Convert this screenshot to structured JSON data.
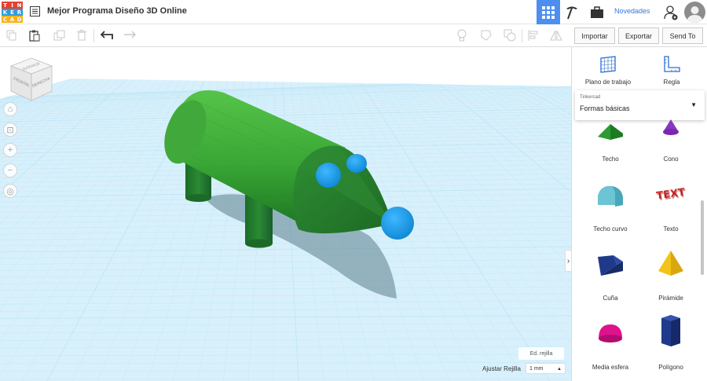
{
  "app": {
    "logo_letters": [
      "T",
      "I",
      "N",
      "K",
      "E",
      "R",
      "C",
      "A",
      "D"
    ],
    "logo_colors": [
      "#e4422f",
      "#e4422f",
      "#e4422f",
      "#2d9cdb",
      "#2d9cdb",
      "#2d9cdb",
      "#f5b31d",
      "#f5b31d",
      "#f5b31d"
    ],
    "title": "Mejor Programa Diseño 3D Online",
    "news_label": "Novedades",
    "accent": "#4d8ff0"
  },
  "toolbar": {
    "import_label": "Importar",
    "export_label": "Exportar",
    "send_label": "Send To"
  },
  "viewcube": {
    "front_label": "FRONTAL",
    "right_label": "DERECHA",
    "top_label": "SUPERIOR"
  },
  "viewport": {
    "edit_grid_label": "Ed. rejilla",
    "snap_label": "Ajustar Rejilla",
    "snap_value": "1 mm",
    "grid_color": "#bfe6f6"
  },
  "panel": {
    "workplane_label": "Plano de trabajo",
    "ruler_label": "Regla",
    "library_small": "Tinkercad",
    "library_value": "Formas básicas",
    "shapes": [
      {
        "label": "Techo",
        "icon": "roof-icon"
      },
      {
        "label": "Cono",
        "icon": "cone-icon"
      },
      {
        "label": "Techo curvo",
        "icon": "curved-roof-icon"
      },
      {
        "label": "Texto",
        "icon": "text-shape-icon"
      },
      {
        "label": "Cuña",
        "icon": "wedge-icon"
      },
      {
        "label": "Pirámide",
        "icon": "pyramid-icon"
      },
      {
        "label": "Media esfera",
        "icon": "half-sphere-icon"
      },
      {
        "label": "Polígono",
        "icon": "polygon-icon"
      }
    ]
  }
}
